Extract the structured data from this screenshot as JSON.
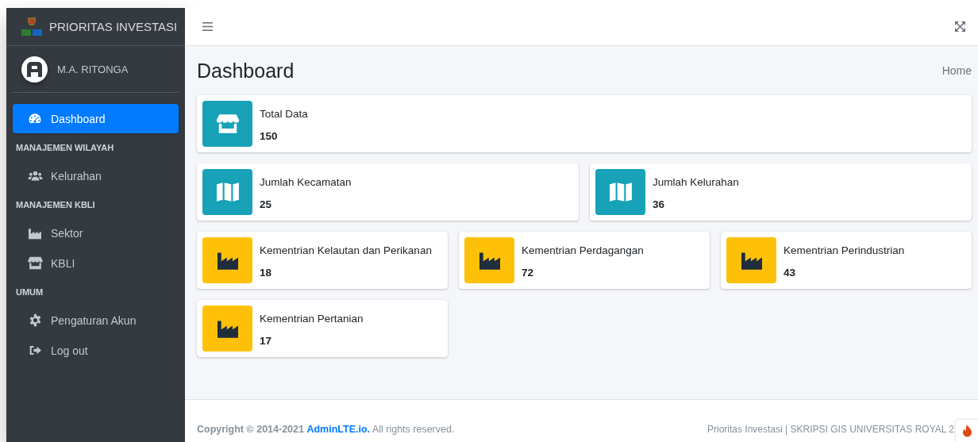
{
  "sidebar": {
    "brand": "PRIORITAS INVESTASI",
    "user": "M.A. RITONGA",
    "nav": [
      {
        "kind": "link",
        "label": "Dashboard",
        "selected": true
      },
      {
        "kind": "header",
        "label": "MANAJEMEN WILAYAH"
      },
      {
        "kind": "link",
        "label": "Kelurahan",
        "selected": false
      },
      {
        "kind": "header",
        "label": "MANAJEMEN KBLI"
      },
      {
        "kind": "link",
        "label": "Sektor",
        "selected": false
      },
      {
        "kind": "link",
        "label": "KBLI",
        "selected": false
      },
      {
        "kind": "header",
        "label": "UMUM"
      },
      {
        "kind": "link",
        "label": "Pengaturan Akun",
        "selected": false
      },
      {
        "kind": "link",
        "label": "Log out",
        "selected": false
      }
    ]
  },
  "page": {
    "title": "Dashboard",
    "breadcrumb": "Home"
  },
  "groups": [
    {
      "boxes": [
        {
          "kind": "total",
          "label": "Total Data",
          "value": "150",
          "color": "#17a2b8"
        }
      ]
    },
    {
      "boxes": [
        {
          "kind": "area",
          "label": "Jumlah Kecamatan",
          "value": "25",
          "color": "#17a2b8"
        },
        {
          "kind": "area",
          "label": "Jumlah Kelurahan",
          "value": "36",
          "color": "#17a2b8"
        }
      ]
    },
    {
      "boxes": [
        {
          "kind": "ministry",
          "label": "Kementrian Kelautan dan Perikanan",
          "value": "18",
          "color": "#ffc107"
        },
        {
          "kind": "ministry",
          "label": "Kementrian Perdagangan",
          "value": "72",
          "color": "#ffc107"
        },
        {
          "kind": "ministry",
          "label": "Kementrian Perindustrian",
          "value": "43",
          "color": "#ffc107"
        },
        {
          "kind": "ministry",
          "label": "Kementrian Pertanian",
          "value": "17",
          "color": "#ffc107"
        }
      ]
    }
  ],
  "footer": {
    "copyright": "Copyright © 2014-2021",
    "link": "AdminLTE.io.",
    "rights": "All rights reserved.",
    "credit": "Prioritas Investasi | SKRIPSI GIS UNIVERSITAS ROYAL 2"
  }
}
